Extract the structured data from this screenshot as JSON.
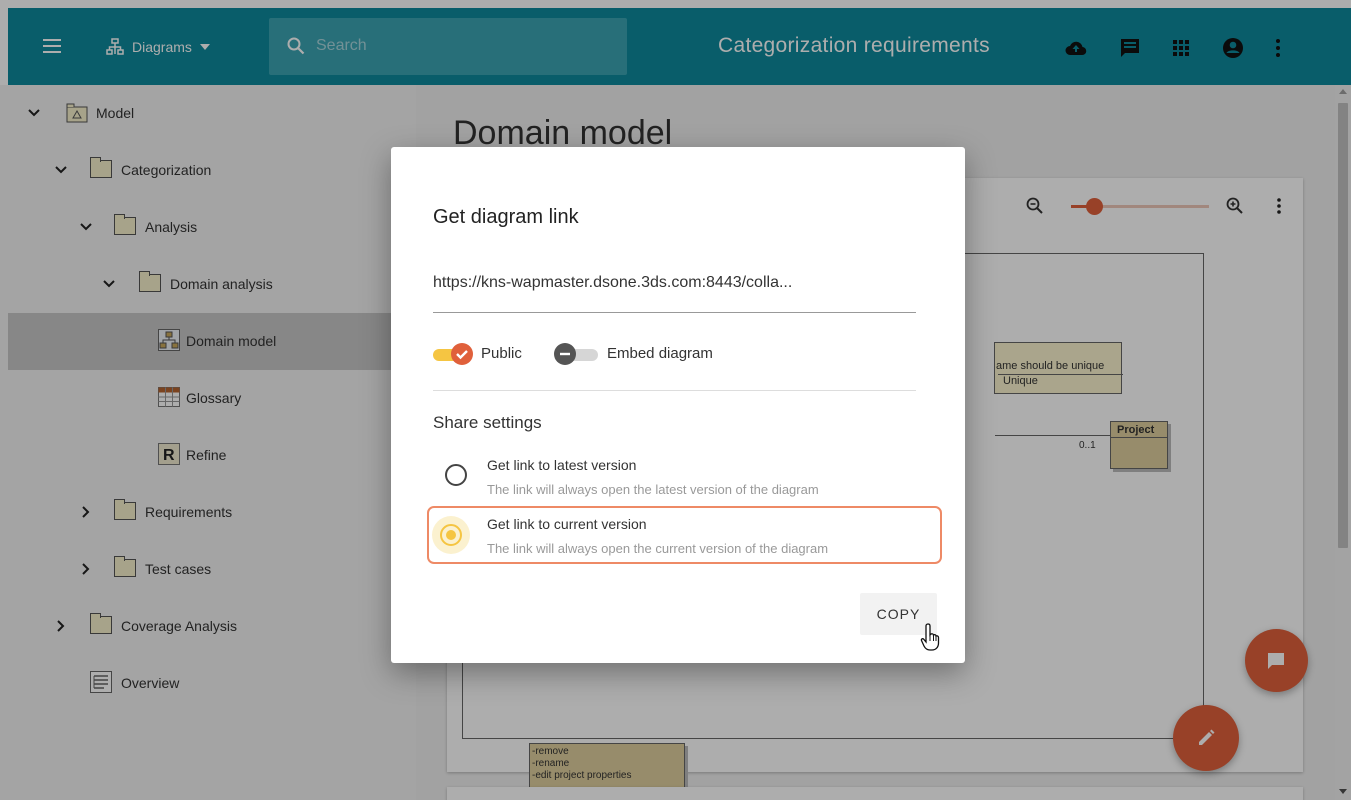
{
  "topbar": {
    "diagrams_label": "Diagrams",
    "search_placeholder": "Search",
    "title": "Categorization requirements",
    "icons": [
      "menu-icon",
      "diagrams-icon",
      "search-icon",
      "cloud-upload-icon",
      "comment-icon",
      "apps-icon",
      "account-icon",
      "more-vert-icon"
    ],
    "color": "#0e8a9c"
  },
  "sidebar": {
    "items": [
      {
        "label": "Model",
        "expanded": true
      },
      {
        "label": "Categorization",
        "expanded": true
      },
      {
        "label": "Analysis",
        "expanded": true
      },
      {
        "label": "Domain analysis",
        "expanded": true
      },
      {
        "label": "Domain model",
        "selected": true
      },
      {
        "label": "Glossary"
      },
      {
        "label": "Refine"
      },
      {
        "label": "Requirements",
        "expanded": false
      },
      {
        "label": "Test cases",
        "expanded": false
      },
      {
        "label": "Coverage Analysis",
        "expanded": false
      },
      {
        "label": "Overview"
      }
    ]
  },
  "main": {
    "title": "Domain model",
    "diagram": {
      "note_line1": "ame should be unique",
      "note_line2": "Unique",
      "class_name": "Project",
      "multiplicity": "0..1",
      "ops": [
        "-remove",
        "-rename",
        "-edit project properties"
      ]
    },
    "zoom_level": 0.17
  },
  "dialog": {
    "title": "Get diagram link",
    "link": "https://kns-wapmaster.dsone.3ds.com:8443/colla...",
    "public_label": "Public",
    "public_on": true,
    "embed_label": "Embed diagram",
    "embed_on": false,
    "share_title": "Share settings",
    "options": [
      {
        "title": "Get link to latest version",
        "subtitle": "The link will always open the latest version of the diagram",
        "selected": false
      },
      {
        "title": "Get link to current version",
        "subtitle": "The link will always open the current version of the diagram",
        "selected": true
      }
    ],
    "copy_label": "COPY"
  },
  "colors": {
    "accent": "#e0603b",
    "toggle_on": "#f5c542",
    "radio_selected": "#f5c542",
    "highlight_border": "#ee8a66"
  }
}
